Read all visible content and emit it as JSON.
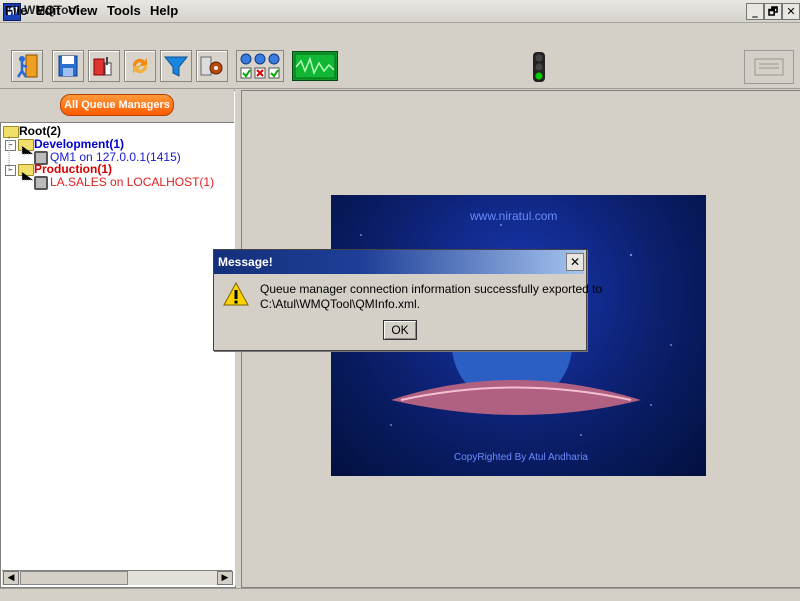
{
  "window": {
    "title": "WMQTool",
    "controls": [
      "_",
      "🗗",
      "✕"
    ]
  },
  "menu": {
    "items": [
      "File",
      "Edit",
      "View",
      "Tools",
      "Help"
    ]
  },
  "toolbar": {
    "buttons": [
      {
        "icon": "exit-icon"
      },
      {
        "icon": "save-icon"
      },
      {
        "icon": "connect-icon"
      },
      {
        "icon": "refresh-icon"
      },
      {
        "icon": "filter-icon"
      },
      {
        "icon": "settings-icon"
      },
      {
        "icon": "status-indicators-icon"
      },
      {
        "icon": "monitor-icon"
      }
    ],
    "traffic_light_colors": [
      "#222",
      "#222",
      "#00cc00"
    ]
  },
  "sidebar": {
    "header_button": "All Queue Managers",
    "tree": {
      "root": "Root(2)",
      "groups": [
        {
          "label": "Development(1)",
          "color": "#0000cc",
          "child": "QM1 on 127.0.0.1(1415)"
        },
        {
          "label": "Production(1)",
          "color": "#d40000",
          "child": "LA.SALES on LOCALHOST(1)"
        }
      ]
    }
  },
  "splash": {
    "url": "www.niratul.com",
    "copyright": "CopyRighted By Atul Andharia"
  },
  "dialog": {
    "title": "Message!",
    "close": "✕",
    "message_line1": "Queue manager connection information successfully exported to",
    "message_line2": "C:\\Atul\\WMQTool\\QMInfo.xml.",
    "ok": "OK"
  }
}
